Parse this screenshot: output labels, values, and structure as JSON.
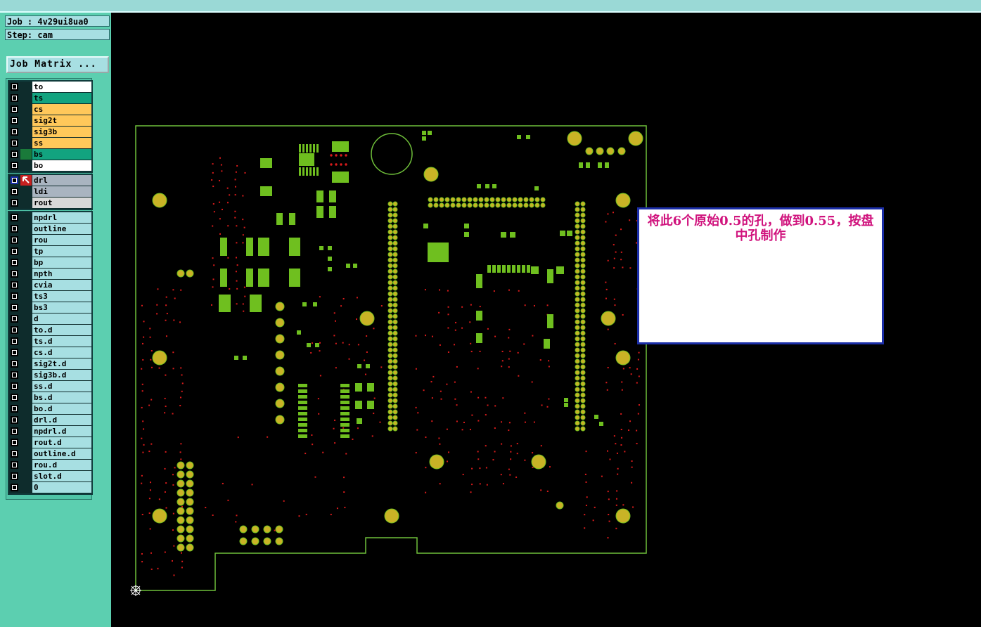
{
  "job_label": "Job : 4v29ui8ua0",
  "step_label": "Step: cam",
  "job_matrix_button": "Job Matrix ...",
  "layer_groups": [
    [
      {
        "name": "to",
        "color": "#ffffff"
      },
      {
        "name": "ts",
        "color": "#12a37f"
      },
      {
        "name": "cs",
        "color": "#ffc85a"
      },
      {
        "name": "sig2t",
        "color": "#ffc85a"
      },
      {
        "name": "sig3b",
        "color": "#ffc85a"
      },
      {
        "name": "ss",
        "color": "#ffc85a"
      },
      {
        "name": "bs",
        "color": "#12a37f",
        "marker": "#1a7a3a"
      },
      {
        "name": "bo",
        "color": "#ffffff"
      }
    ],
    [
      {
        "name": "drl",
        "color": "#a9b4c0",
        "active": true
      },
      {
        "name": "ldi",
        "color": "#a9b4c0"
      },
      {
        "name": "rout",
        "color": "#d8d8d8"
      }
    ],
    [
      {
        "name": "npdrl",
        "color": "#a7dfe2"
      },
      {
        "name": "outline",
        "color": "#a7dfe2"
      },
      {
        "name": "rou",
        "color": "#a7dfe2"
      },
      {
        "name": "tp",
        "color": "#a7dfe2"
      },
      {
        "name": "bp",
        "color": "#a7dfe2"
      },
      {
        "name": "npth",
        "color": "#a7dfe2"
      },
      {
        "name": "cvia",
        "color": "#a7dfe2"
      },
      {
        "name": "ts3",
        "color": "#a7dfe2"
      },
      {
        "name": "bs3",
        "color": "#a7dfe2"
      },
      {
        "name": "d",
        "color": "#a7dfe2"
      },
      {
        "name": "to.d",
        "color": "#a7dfe2"
      },
      {
        "name": "ts.d",
        "color": "#a7dfe2"
      },
      {
        "name": "cs.d",
        "color": "#a7dfe2"
      },
      {
        "name": "sig2t.d",
        "color": "#a7dfe2"
      },
      {
        "name": "sig3b.d",
        "color": "#a7dfe2"
      },
      {
        "name": "ss.d",
        "color": "#a7dfe2"
      },
      {
        "name": "bs.d",
        "color": "#a7dfe2"
      },
      {
        "name": "bo.d",
        "color": "#a7dfe2"
      },
      {
        "name": "drl.d",
        "color": "#a7dfe2"
      },
      {
        "name": "npdrl.d",
        "color": "#a7dfe2"
      },
      {
        "name": "rout.d",
        "color": "#a7dfe2"
      },
      {
        "name": "outline.d",
        "color": "#a7dfe2"
      },
      {
        "name": "rou.d",
        "color": "#a7dfe2"
      },
      {
        "name": "slot.d",
        "color": "#a7dfe2"
      },
      {
        "name": "0",
        "color": "#a7dfe2"
      }
    ]
  ],
  "note_text": "将此6个原始0.5的孔，做到0.55，按盘中孔制作",
  "colors": {
    "board_outline": "#6fbf3a",
    "pad_green": "#6fbf1f",
    "hole_gold": "#c9b326",
    "via_red": "#d81b1b",
    "note_text": "#d0137d",
    "note_border": "#1b2ea8"
  },
  "icons": {
    "active_layer": "cursor-arrow-icon",
    "origin": "origin-crosshair-icon"
  }
}
